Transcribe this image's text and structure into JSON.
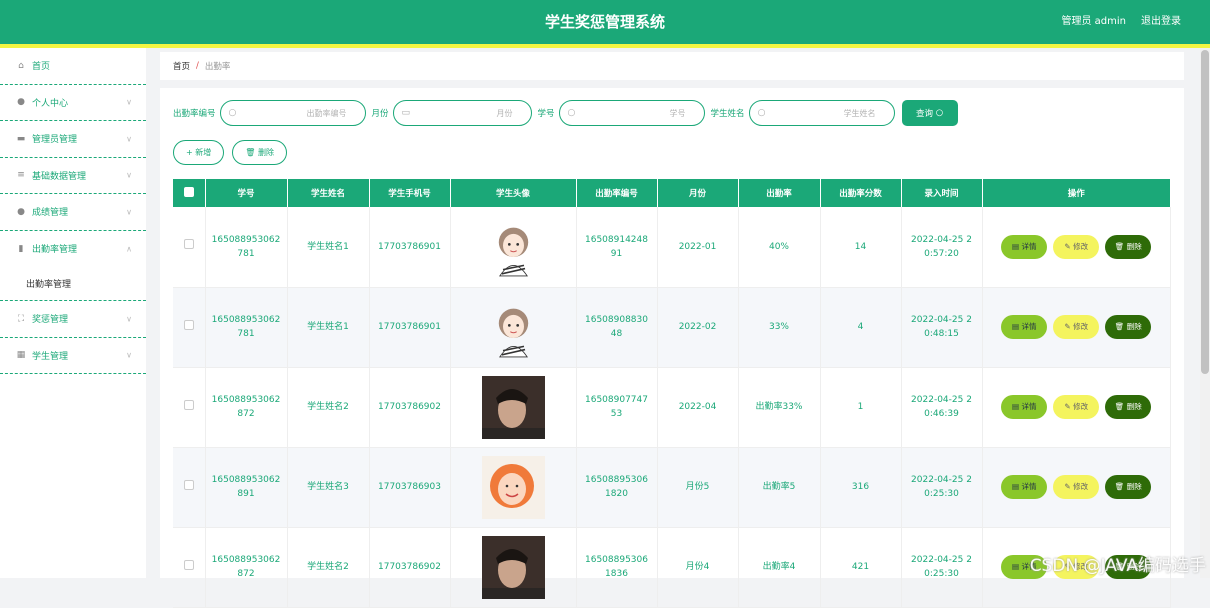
{
  "header": {
    "title": "学生奖惩管理系统",
    "user": "管理员 admin",
    "logout": "退出登录"
  },
  "colors": {
    "primary": "#1ba878",
    "accent_yellow": "#f3f542",
    "detail": "#8ac72a",
    "edit": "#f4f45e",
    "delete": "#2e6b08"
  },
  "sidebar": {
    "items": [
      {
        "label": "首页",
        "icon": "home-icon"
      },
      {
        "label": "个人中心",
        "icon": "user-icon"
      },
      {
        "label": "管理员管理",
        "icon": "monitor-icon"
      },
      {
        "label": "基础数据管理",
        "icon": "list-icon"
      },
      {
        "label": "成绩管理",
        "icon": "user-icon"
      },
      {
        "label": "出勤率管理",
        "icon": "bar-chart-icon"
      },
      {
        "label": "奖惩管理",
        "icon": "frame-icon"
      },
      {
        "label": "学生管理",
        "icon": "grid-icon"
      }
    ],
    "sub": "出勤率管理"
  },
  "breadcrumb": {
    "home": "首页",
    "sep": "/",
    "current": "出勤率"
  },
  "search": {
    "f1_label": "出勤率编号",
    "f1_ph": "出勤率编号",
    "f2_label": "月份",
    "f2_ph": "月份",
    "f3_label": "学号",
    "f3_ph": "学号",
    "f4_label": "学生姓名",
    "f4_ph": "学生姓名",
    "button": "查询"
  },
  "actions": {
    "add": "新增",
    "delete": "删除"
  },
  "table": {
    "headers": [
      "学号",
      "学生姓名",
      "学生手机号",
      "学生头像",
      "出勤率编号",
      "月份",
      "出勤率",
      "出勤率分数",
      "录入时间",
      "操作"
    ],
    "rows": [
      {
        "id": "165088953062781",
        "name": "学生姓名1",
        "phone": "17703786901",
        "avatar": "girl",
        "code": "1650891424891",
        "month": "2022-01",
        "rate": "40%",
        "score": "14",
        "time": "2022-04-25 20:57:20"
      },
      {
        "id": "165088953062781",
        "name": "学生姓名1",
        "phone": "17703786901",
        "avatar": "girl",
        "code": "1650890883048",
        "month": "2022-02",
        "rate": "33%",
        "score": "4",
        "time": "2022-04-25 20:48:15"
      },
      {
        "id": "165088953062872",
        "name": "学生姓名2",
        "phone": "17703786902",
        "avatar": "boy",
        "code": "1650890774753",
        "month": "2022-04",
        "rate": "出勤率33%",
        "score": "1",
        "time": "2022-04-25 20:46:39"
      },
      {
        "id": "165088953062891",
        "name": "学生姓名3",
        "phone": "17703786903",
        "avatar": "woman",
        "code": "165088953061820",
        "month": "月份5",
        "rate": "出勤率5",
        "score": "316",
        "time": "2022-04-25 20:25:30"
      },
      {
        "id": "165088953062872",
        "name": "学生姓名2",
        "phone": "17703786902",
        "avatar": "boy",
        "code": "165088953061836",
        "month": "月份4",
        "rate": "出勤率4",
        "score": "421",
        "time": "2022-04-25 20:25:30"
      }
    ],
    "ops": {
      "detail": "详情",
      "edit": "修改",
      "delete": "删除"
    }
  },
  "watermark": "CSDN @JAVA编码选手"
}
